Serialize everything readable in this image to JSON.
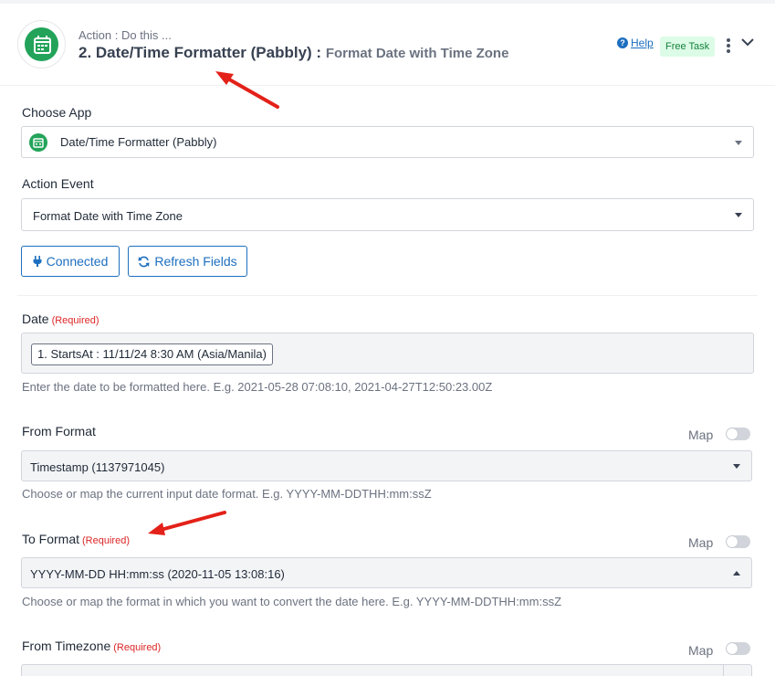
{
  "header": {
    "subtitle": "Action : Do this ...",
    "title": "2. Date/Time Formatter (Pabbly) :",
    "event": "Format Date with Time Zone",
    "help_label": "Help",
    "badge_label": "Free Task",
    "app_icon": "calendar-icon"
  },
  "choose_app": {
    "label": "Choose App",
    "value": "Date/Time Formatter (Pabbly)"
  },
  "action_event": {
    "label": "Action Event",
    "value": "Format Date with Time Zone"
  },
  "buttons": {
    "connected_label": "Connected",
    "refresh_label": "Refresh Fields"
  },
  "date": {
    "label": "Date",
    "required": "(Required)",
    "chip": "1. StartsAt : 11/11/24 8:30 AM (Asia/Manila)",
    "help": "Enter the date to be formatted here. E.g. 2021-05-28 07:08:10, 2021-04-27T12:50:23.00Z"
  },
  "from_format": {
    "label": "From Format",
    "map_label": "Map",
    "value": "Timestamp (1137971045)",
    "help": "Choose or map the current input date format. E.g. YYYY-MM-DDTHH:mm:ssZ"
  },
  "to_format": {
    "label": "To Format",
    "required": "(Required)",
    "map_label": "Map",
    "value": "YYYY-MM-DD HH:mm:ss (2020-11-05 13:08:16)",
    "help": "Choose or map the format in which you want to convert the date here. E.g. YYYY-MM-DDTHH:mm:ssZ"
  },
  "from_timezone": {
    "label": "From Timezone",
    "required": "(Required)",
    "map_label": "Map"
  },
  "colors": {
    "accent": "#1d6fbf",
    "app_green": "#23a35a",
    "required_red": "#dc2626",
    "annotation_red": "#e32119"
  }
}
